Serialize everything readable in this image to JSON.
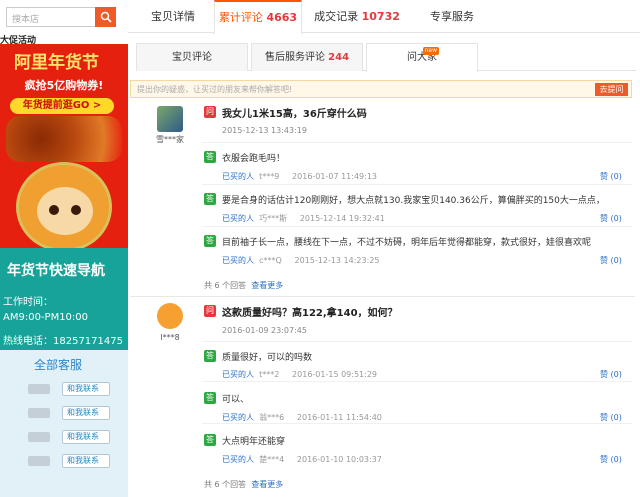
{
  "sidebar": {
    "search_placeholder": "搜本店",
    "promo_title": "大促活动",
    "banner": {
      "logo": "阿里年货节",
      "grab": "疯抢5亿购物券!",
      "early": "年货提前逛GO >"
    },
    "guide": {
      "title": "年货节快速导航",
      "work_label": "工作时间：",
      "work_hours": "AM9:00-PM10:00",
      "hotline": "热线电话：18257171475"
    },
    "service": {
      "title": "全部客服",
      "contact_label": "和我联系",
      "count": 4
    }
  },
  "tabs": [
    {
      "label": "宝贝详情",
      "count": ""
    },
    {
      "label": "累计评论",
      "count": "4663"
    },
    {
      "label": "成交记录",
      "count": "10732"
    },
    {
      "label": "专享服务",
      "count": ""
    }
  ],
  "subtabs": [
    {
      "label": "宝贝评论",
      "count": ""
    },
    {
      "label": "售后服务评论",
      "count": "244"
    },
    {
      "label": "问大家",
      "count": "",
      "badge": "new"
    }
  ],
  "ask": {
    "placeholder": "提出你的疑惑，让买过的朋友来帮你解答吧!",
    "button": "去提问"
  },
  "questions": [
    {
      "user": "雪***家",
      "question": "我女儿1米15高，36斤穿什么码",
      "date": "2015-12-13 13:43:19",
      "answers": [
        {
          "text": "衣服会跑毛吗！",
          "buyer_label": "已买的人",
          "user": "t***9",
          "date": "2016-01-07 11:49:13",
          "zan": "赞 (0)"
        },
        {
          "text": "要是合身的话估计120刚刚好，想大点就130.我家宝贝140.36公斤，算偏胖买的150大一点点，",
          "buyer_label": "已买的人",
          "user": "巧***斯",
          "date": "2015-12-14 19:32:41",
          "zan": "赞 (0)"
        },
        {
          "text": "目前袖子长一点，腰线在下一点，不过不妨碍，明年后年觉得都能穿，款式很好，娃很喜欢呢",
          "buyer_label": "已买的人",
          "user": "c***Q",
          "date": "2015-12-13 14:23:25",
          "zan": "赞 (0)"
        }
      ],
      "total": "共 6 个回答",
      "more": "查看更多"
    },
    {
      "user": "l***8",
      "question": "这款质量好吗？高122,拿140，如何？",
      "date": "2016-01-09 23:07:45",
      "answers": [
        {
          "text": "质量很好，可以的吗数",
          "buyer_label": "已买的人",
          "user": "t***2",
          "date": "2016-01-15 09:51:29",
          "zan": "赞 (0)"
        },
        {
          "text": "可以、",
          "buyer_label": "已买的人",
          "user": "翁***6",
          "date": "2016-01-11 11:54:40",
          "zan": "赞 (0)"
        },
        {
          "text": "大点明年还能穿",
          "buyer_label": "已买的人",
          "user": "楚***4",
          "date": "2016-01-10 10:03:37",
          "zan": "赞 (0)"
        }
      ],
      "total": "共 6 个回答",
      "more": "查看更多"
    }
  ],
  "icons": {
    "question": "问",
    "answer": "答"
  },
  "colors": {
    "accent": "#ff5400",
    "teal": "#18a39a",
    "banner": "#e5200e",
    "count": "#e4393c"
  }
}
